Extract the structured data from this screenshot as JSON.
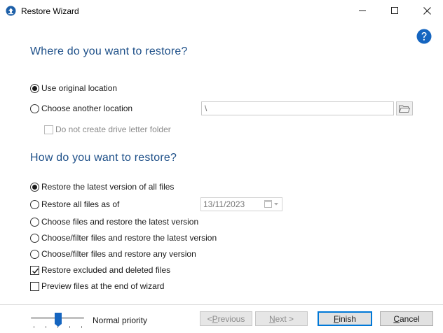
{
  "window": {
    "title": "Restore Wizard",
    "controls": [
      "minimize",
      "maximize",
      "close"
    ]
  },
  "icons": {
    "app": "upload-cloud-icon",
    "help": "question-mark-icon",
    "browse": "folder-icon",
    "calendar": "calendar-icon"
  },
  "colors": {
    "accent": "#1d4f88",
    "help": "#1565c0",
    "slider_thumb": "#1565c0",
    "default_button_border": "#0078d7"
  },
  "where": {
    "title": "Where do you want to restore?",
    "options": [
      {
        "label": "Use original location",
        "selected": true
      },
      {
        "label": "Choose another location",
        "selected": false
      }
    ],
    "location_value": "\\",
    "no_drive_letter": {
      "label": "Do not create drive letter folder",
      "checked": false,
      "enabled": false
    }
  },
  "how": {
    "title": "How do you want to restore?",
    "options": [
      {
        "label": "Restore the latest version of all files",
        "selected": true
      },
      {
        "label": "Restore all files as of",
        "selected": false
      },
      {
        "label": "Choose files and restore the latest version",
        "selected": false
      },
      {
        "label": "Choose/filter files and restore the latest version",
        "selected": false
      },
      {
        "label": "Choose/filter files and restore any version",
        "selected": false
      }
    ],
    "date_value": "13/11/2023",
    "restore_excluded": {
      "label": "Restore excluded and deleted files",
      "checked": true
    },
    "preview_files": {
      "label": "Preview files at the end of wizard",
      "checked": false
    }
  },
  "footer": {
    "priority_label": "Normal priority",
    "priority_level": 0.5,
    "buttons": {
      "previous": "< Previous",
      "next": "Next >",
      "finish": "Finish",
      "cancel": "Cancel"
    }
  }
}
